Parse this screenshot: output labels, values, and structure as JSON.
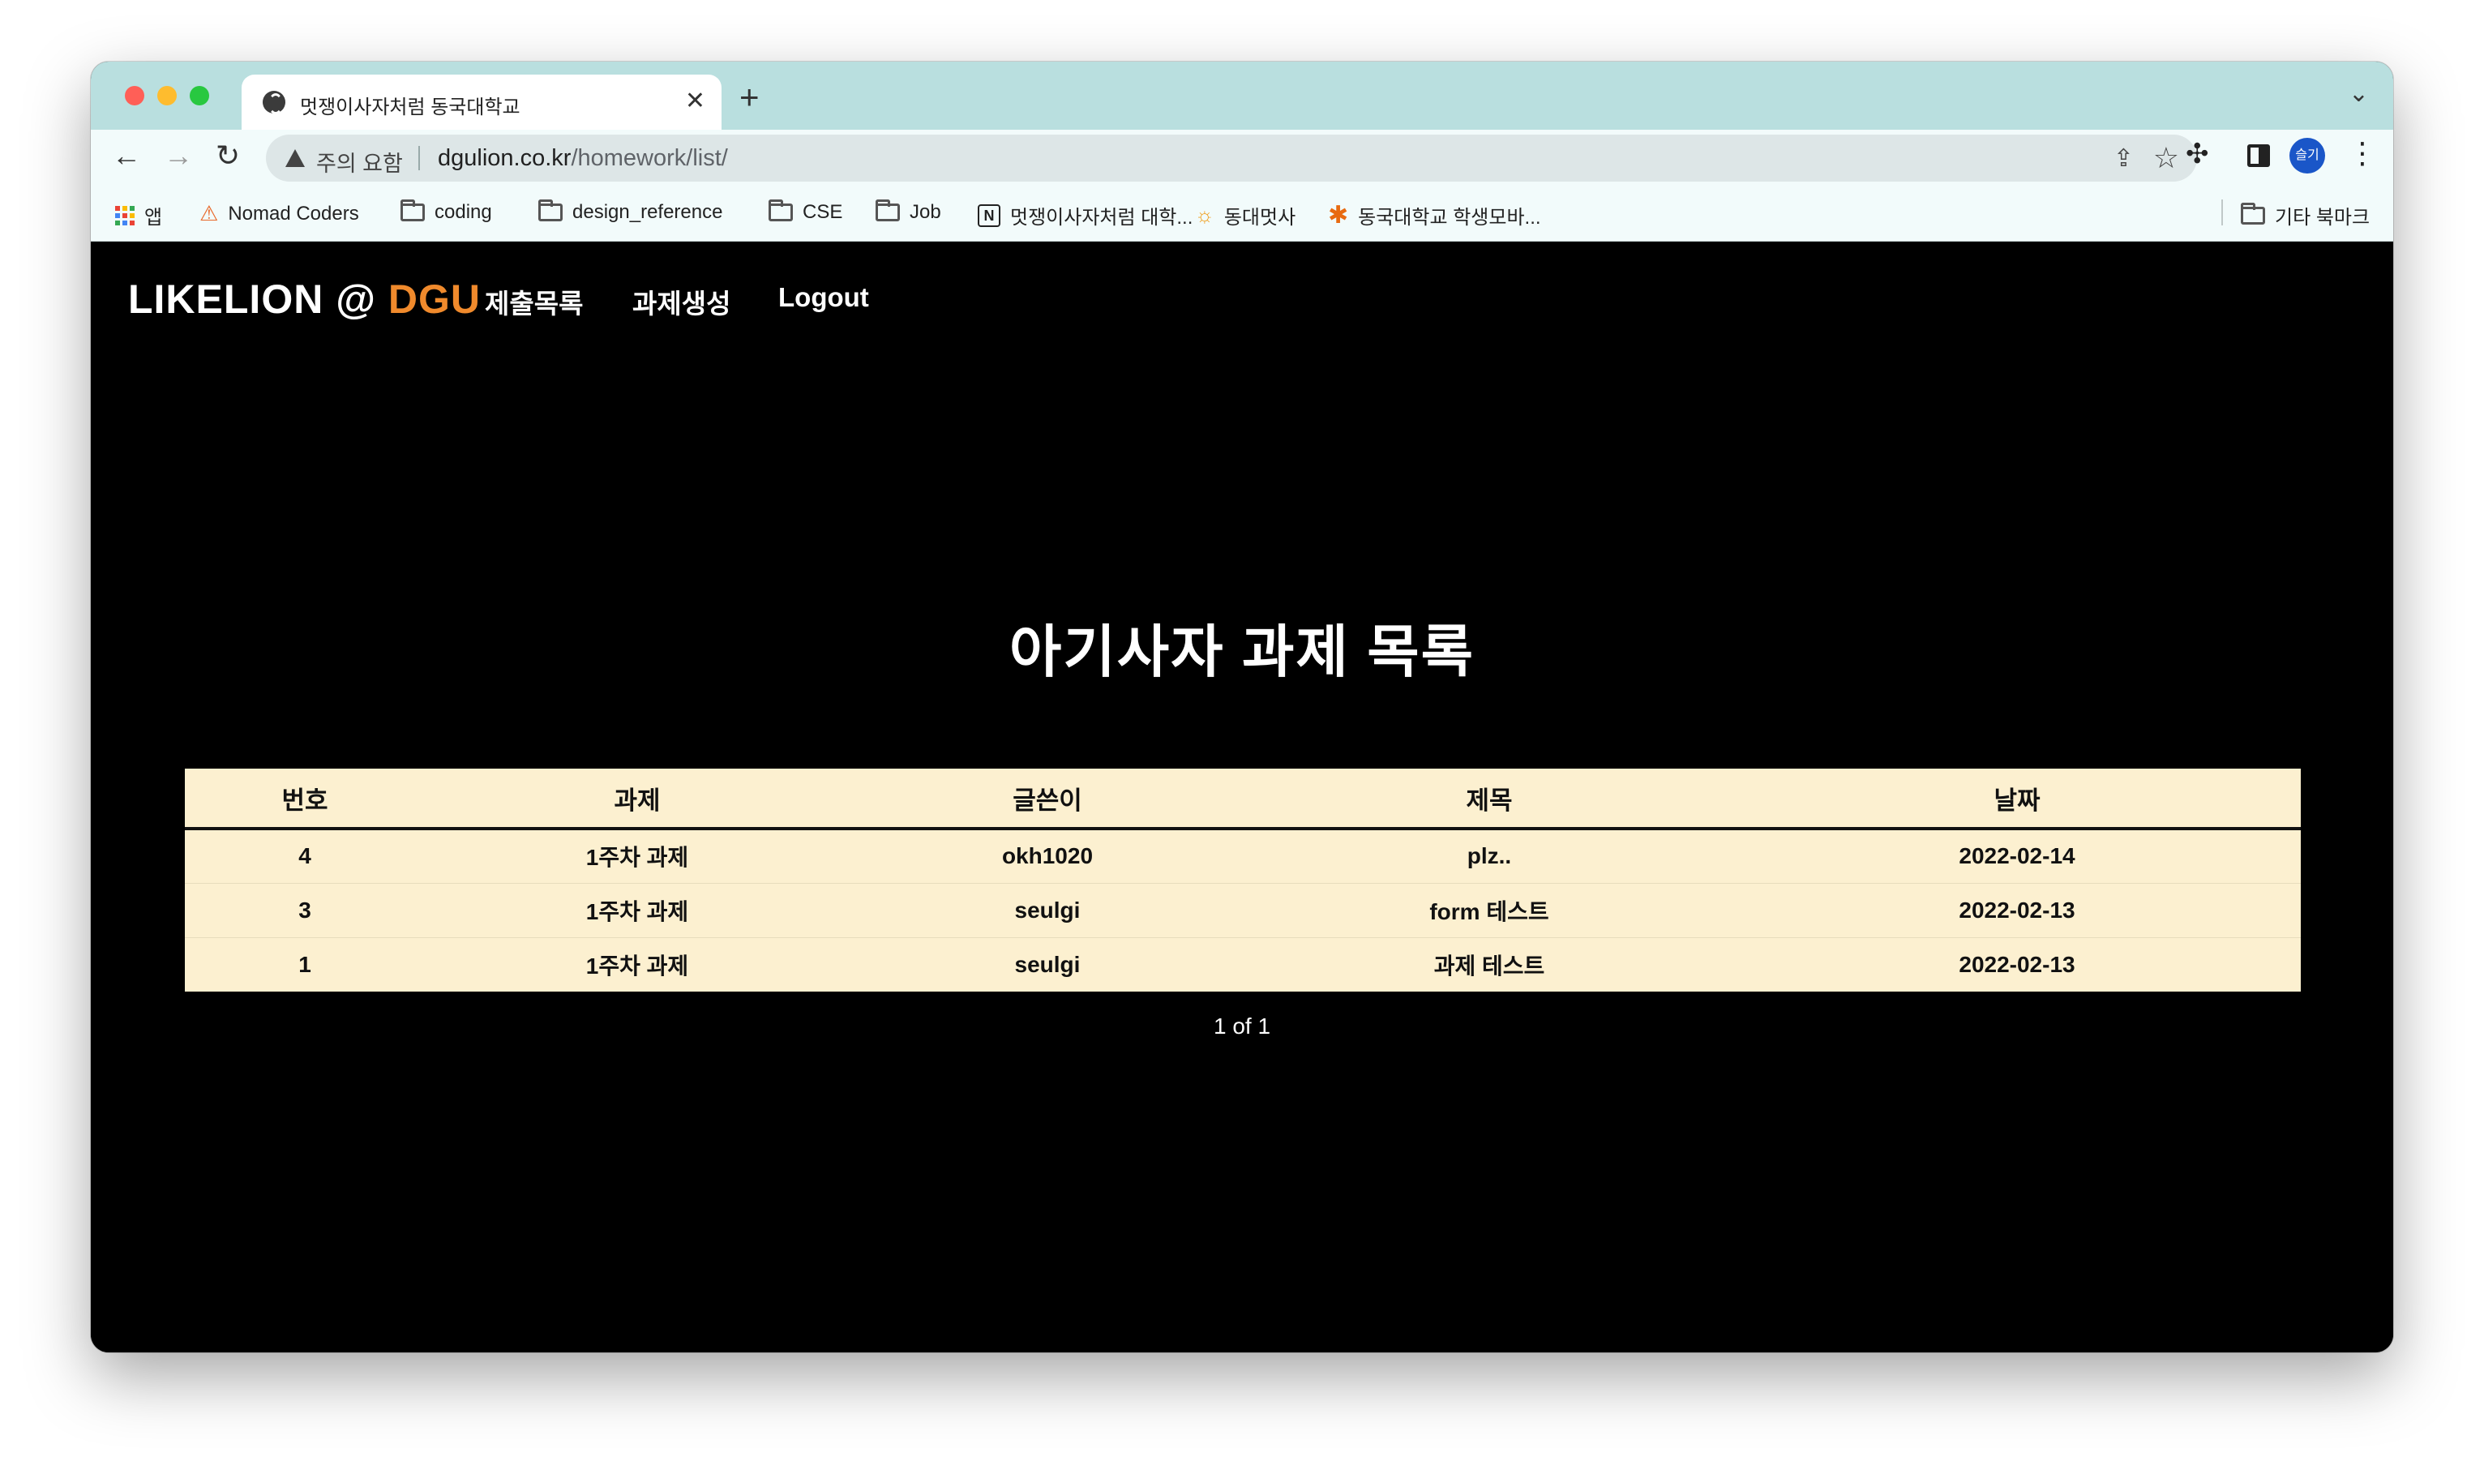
{
  "browser": {
    "tab_title": "멋쟁이사자처럼 동국대학교",
    "security_label": "주의 요함",
    "url_domain": "dgulion.co.kr",
    "url_path": "/homework/list/",
    "profile_label": "슬기",
    "bookmarks": [
      {
        "label": "앱",
        "icon": "apps-grid-icon"
      },
      {
        "label": "Nomad Coders",
        "icon": "nomad-icon"
      },
      {
        "label": "coding",
        "icon": "folder-icon"
      },
      {
        "label": "design_reference",
        "icon": "folder-icon"
      },
      {
        "label": "CSE",
        "icon": "folder-icon"
      },
      {
        "label": "Job",
        "icon": "folder-icon"
      },
      {
        "label": "멋쟁이사자처럼 대학...",
        "icon": "notion-icon"
      },
      {
        "label": "동대멋사",
        "icon": "sun-icon"
      },
      {
        "label": "동국대학교 학생모바...",
        "icon": "flower-icon"
      }
    ],
    "other_bookmarks": "기타 북마크"
  },
  "site": {
    "brand_main": "LIKELION @ ",
    "brand_accent": "DGU",
    "nav": [
      "제출목록",
      "과제생성",
      "Logout"
    ]
  },
  "page": {
    "heading": "아기사자 과제 목록",
    "columns": [
      "번호",
      "과제",
      "글쓴이",
      "제목",
      "날짜"
    ],
    "rows": [
      [
        "4",
        "1주차 과제",
        "okh1020",
        "plz..",
        "2022-02-14"
      ],
      [
        "3",
        "1주차 과제",
        "seulgi",
        "form 테스트",
        "2022-02-13"
      ],
      [
        "1",
        "1주차 과제",
        "seulgi",
        "과제 테스트",
        "2022-02-13"
      ]
    ],
    "pagination": "1 of 1"
  },
  "colors": {
    "tab_strip": "#b9dfdf",
    "brand_accent": "#f08a2c",
    "table_bg": "#fcf0d0",
    "page_bg": "#000000"
  }
}
